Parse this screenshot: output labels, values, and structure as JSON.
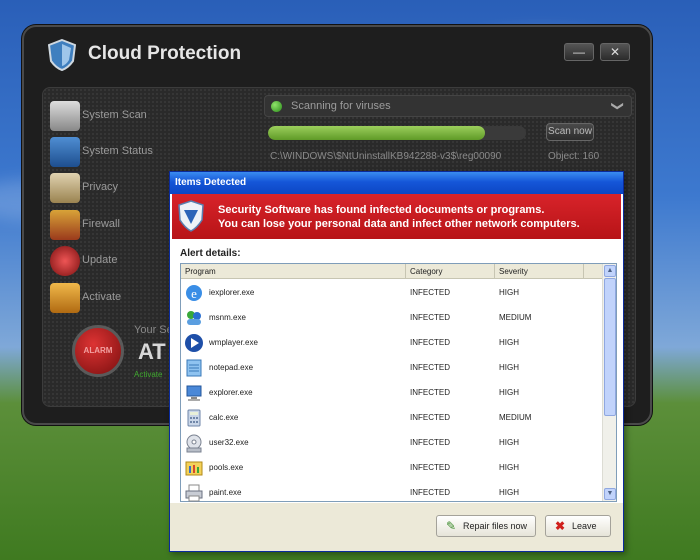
{
  "app": {
    "title": "Cloud Protection",
    "minimize_glyph": "—",
    "close_glyph": "✕",
    "nav": [
      {
        "label": "System Scan",
        "icon": "magnifier-icon"
      },
      {
        "label": "System Status",
        "icon": "pulse-icon"
      },
      {
        "label": "Privacy",
        "icon": "folder-icon"
      },
      {
        "label": "Firewall",
        "icon": "brick-wall-icon"
      },
      {
        "label": "Update",
        "icon": "update-icon"
      },
      {
        "label": "Activate",
        "icon": "keys-icon"
      }
    ],
    "scan": {
      "status_text": "Scanning for viruses",
      "chevron": "❯",
      "progress": 0.84,
      "scan_now_label": "Scan now",
      "path": "C:\\WINDOWS\\$NtUninstallKB942288-v3$\\reg00090",
      "object": "Object: 160"
    },
    "alarm_label": "ALARM",
    "status_small": "Your Se",
    "status_big": "AT",
    "status_link": "Activate"
  },
  "dialog": {
    "title": "Items Detected",
    "banner_line1": "Security Software has found infected documents or programs.",
    "banner_line2": "You can lose your personal data and infect other network computers.",
    "alert_label": "Alert details:",
    "columns": [
      "Program",
      "Category",
      "Severity"
    ],
    "rows": [
      {
        "program": "iexplorer.exe",
        "category": "INFECTED",
        "severity": "HIGH",
        "icon": "internet-explorer-icon"
      },
      {
        "program": "msnm.exe",
        "category": "INFECTED",
        "severity": "MEDIUM",
        "icon": "msn-messenger-icon"
      },
      {
        "program": "wmplayer.exe",
        "category": "INFECTED",
        "severity": "HIGH",
        "icon": "media-player-icon"
      },
      {
        "program": "notepad.exe",
        "category": "INFECTED",
        "severity": "HIGH",
        "icon": "notepad-icon"
      },
      {
        "program": "explorer.exe",
        "category": "INFECTED",
        "severity": "HIGH",
        "icon": "computer-icon"
      },
      {
        "program": "calc.exe",
        "category": "INFECTED",
        "severity": "MEDIUM",
        "icon": "calculator-icon"
      },
      {
        "program": "user32.exe",
        "category": "INFECTED",
        "severity": "HIGH",
        "icon": "cd-drive-icon"
      },
      {
        "program": "pools.exe",
        "category": "INFECTED",
        "severity": "HIGH",
        "icon": "control-panel-icon"
      },
      {
        "program": "paint.exe",
        "category": "INFECTED",
        "severity": "HIGH",
        "icon": "printer-icon"
      }
    ],
    "repair_label": "Repair files now",
    "leave_label": "Leave"
  }
}
